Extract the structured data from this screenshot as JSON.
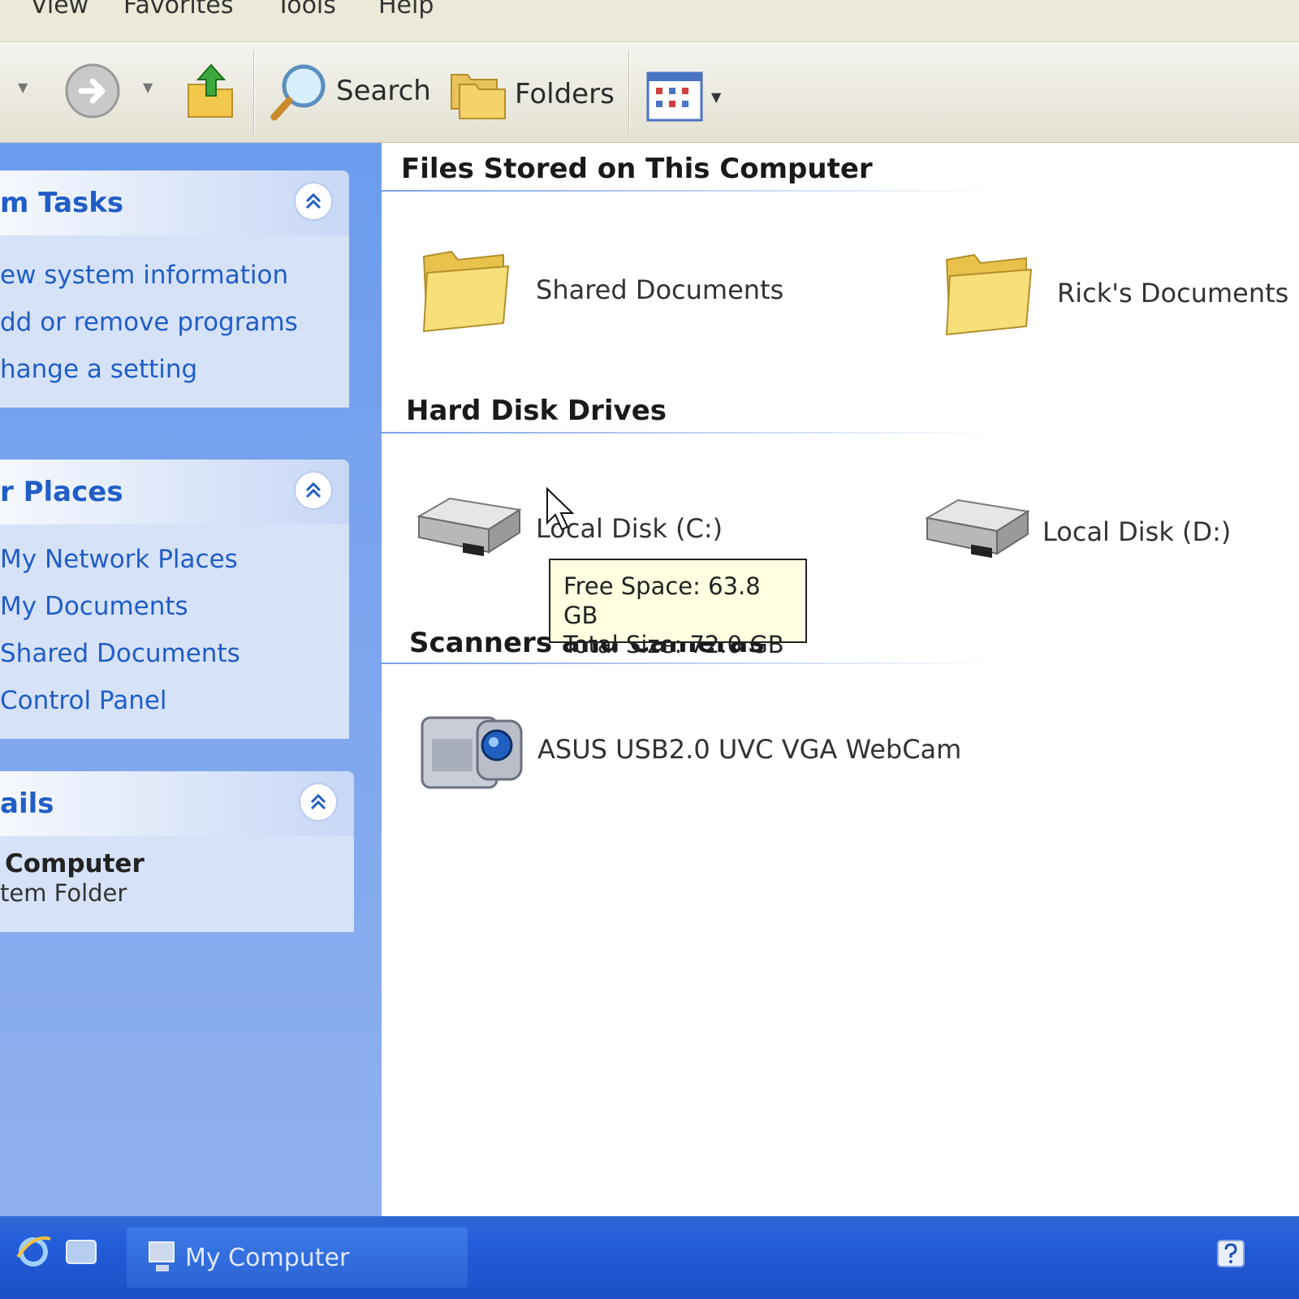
{
  "menu": {
    "items": [
      {
        "label": "View"
      },
      {
        "label": "Favorites"
      },
      {
        "label": "Tools"
      },
      {
        "label": "Help"
      }
    ]
  },
  "toolbar": {
    "search_label": "Search",
    "folders_label": "Folders",
    "icons": {
      "back": "back-arrow-icon",
      "forward": "forward-arrow-icon",
      "up": "up-folder-icon",
      "search": "magnifier-icon",
      "folders": "folders-icon",
      "views": "views-icon"
    }
  },
  "taskpane": {
    "system_tasks": {
      "title": "m Tasks",
      "links": [
        {
          "label": "ew system information"
        },
        {
          "label": "dd or remove programs"
        },
        {
          "label": "hange a setting"
        }
      ]
    },
    "other_places": {
      "title": "r Places",
      "links": [
        {
          "label": "My Network Places"
        },
        {
          "label": "My Documents"
        },
        {
          "label": "Shared Documents"
        },
        {
          "label": "Control Panel"
        }
      ]
    },
    "details": {
      "title": "ails",
      "name": "Computer",
      "type": "tem Folder"
    }
  },
  "content": {
    "groups": [
      {
        "title": "Files Stored on This Computer"
      },
      {
        "title": "Hard Disk Drives"
      },
      {
        "title": "Scanners and Cameras"
      }
    ],
    "items": {
      "shared_documents": "Shared Documents",
      "ricks_documents": "Rick's Documents",
      "local_disk_c": "Local Disk (C:)",
      "local_disk_d": "Local Disk (D:)",
      "webcam": "ASUS USB2.0 UVC VGA WebCam"
    },
    "tooltip": {
      "free_space": "Free Space: 63.8 GB",
      "total_size": "Total Size: 72.0 GB"
    }
  },
  "taskbar": {
    "window_label": "My Computer"
  },
  "colors": {
    "link": "#215dc6",
    "taskpane": "#7ba4ee",
    "taskbar": "#245edb",
    "tooltip_bg": "#ffffe1"
  }
}
